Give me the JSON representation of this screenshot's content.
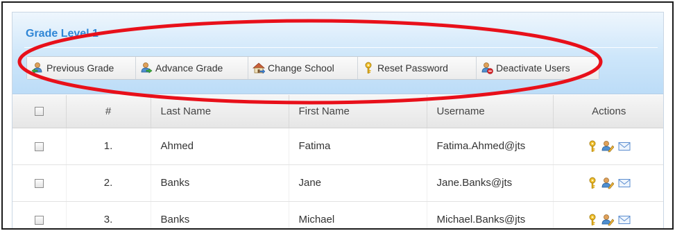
{
  "panel": {
    "title": "Grade Level 1"
  },
  "toolbar": {
    "buttons": [
      {
        "label": "Previous Grade",
        "icon": "user-arrow-left-icon"
      },
      {
        "label": "Advance Grade",
        "icon": "user-arrow-right-icon"
      },
      {
        "label": "Change School",
        "icon": "school-icon"
      },
      {
        "label": "Reset Password",
        "icon": "key-icon"
      },
      {
        "label": "Deactivate Users",
        "icon": "user-remove-icon"
      }
    ]
  },
  "annotation": {
    "color": "#e8101a"
  },
  "table": {
    "columns": {
      "number": "#",
      "last_name": "Last Name",
      "first_name": "First Name",
      "username": "Username",
      "actions": "Actions"
    },
    "rows": [
      {
        "number": "1.",
        "last_name": "Ahmed",
        "first_name": "Fatima",
        "username": "Fatima.Ahmed@jts"
      },
      {
        "number": "2.",
        "last_name": "Banks",
        "first_name": "Jane",
        "username": "Jane.Banks@jts"
      },
      {
        "number": "3.",
        "last_name": "Banks",
        "first_name": "Michael",
        "username": "Michael.Banks@jts"
      }
    ],
    "row_action_icons": [
      "key-icon",
      "user-edit-icon",
      "mail-icon"
    ]
  },
  "colors": {
    "title": "#2f86d6",
    "header_gradient_top": "#eef6fd",
    "header_gradient_bottom": "#bcdcf7"
  }
}
